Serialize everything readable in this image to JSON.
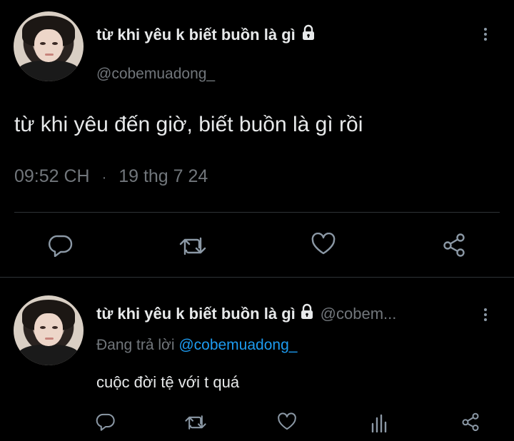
{
  "tweet": {
    "display_name": "từ khi yêu k biết buồn là gì",
    "handle": "@cobemuadong_",
    "text": "từ khi yêu đến giờ, biết buồn là gì rồi",
    "time": "09:52 CH",
    "separator": "·",
    "date": "19 thg 7 24"
  },
  "reply": {
    "display_name": "từ khi yêu k biết buồn là gì",
    "handle": "@cobem...",
    "replying_prefix": "Đang trả lời",
    "replying_to": "@cobemuadong_",
    "text": "cuộc đời tệ với t quá"
  },
  "colors": {
    "background": "#000000",
    "text": "#e7e9ea",
    "muted": "#71767b",
    "link": "#1d9bf0",
    "icon": "#8b98a5"
  },
  "icons": [
    "lock-icon",
    "more-icon",
    "reply-icon",
    "retweet-icon",
    "like-icon",
    "share-icon",
    "analytics-icon"
  ]
}
